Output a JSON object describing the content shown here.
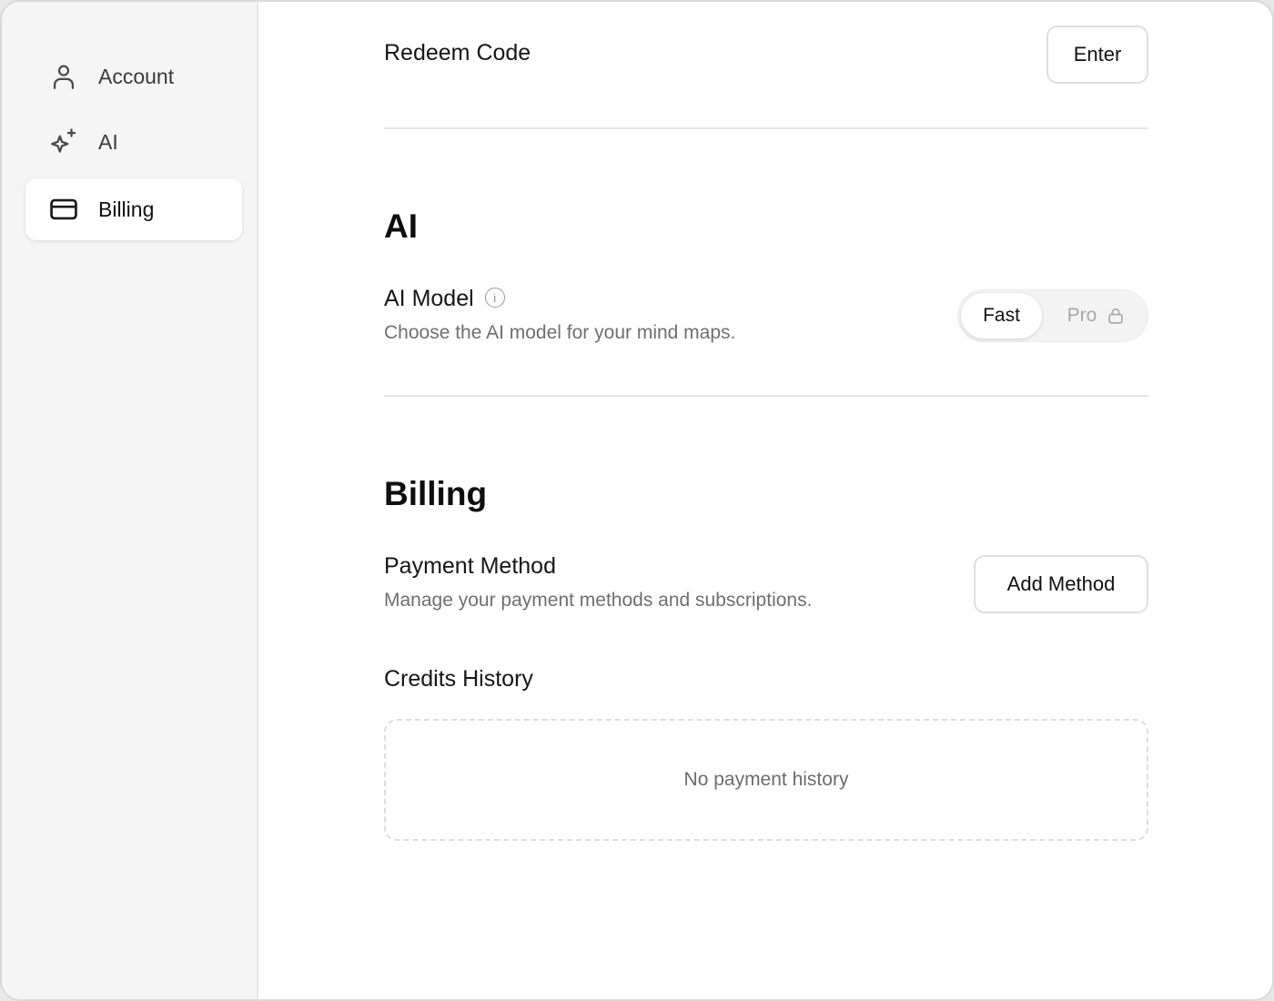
{
  "sidebar": {
    "items": [
      {
        "label": "Account",
        "icon": "user-icon",
        "active": false
      },
      {
        "label": "AI",
        "icon": "sparkles-icon",
        "active": false
      },
      {
        "label": "Billing",
        "icon": "credit-card-icon",
        "active": true
      }
    ]
  },
  "redeem": {
    "title": "Redeem Code",
    "button_label": "Enter"
  },
  "ai_section": {
    "heading": "AI",
    "model_title": "AI Model",
    "info_glyph": "i",
    "model_description": "Choose the AI model for your mind maps.",
    "options": [
      {
        "label": "Fast",
        "selected": true,
        "locked": false
      },
      {
        "label": "Pro",
        "selected": false,
        "locked": true
      }
    ]
  },
  "billing_section": {
    "heading": "Billing",
    "payment_title": "Payment Method",
    "payment_description": "Manage your payment methods and subscriptions.",
    "add_method_label": "Add Method",
    "credits_history_title": "Credits History",
    "empty_history_text": "No payment history"
  },
  "colors": {
    "sidebar_bg": "#f5f5f5",
    "active_item_bg": "#ffffff",
    "muted_text": "#6f6f6f",
    "divider": "#e4e4e4"
  }
}
